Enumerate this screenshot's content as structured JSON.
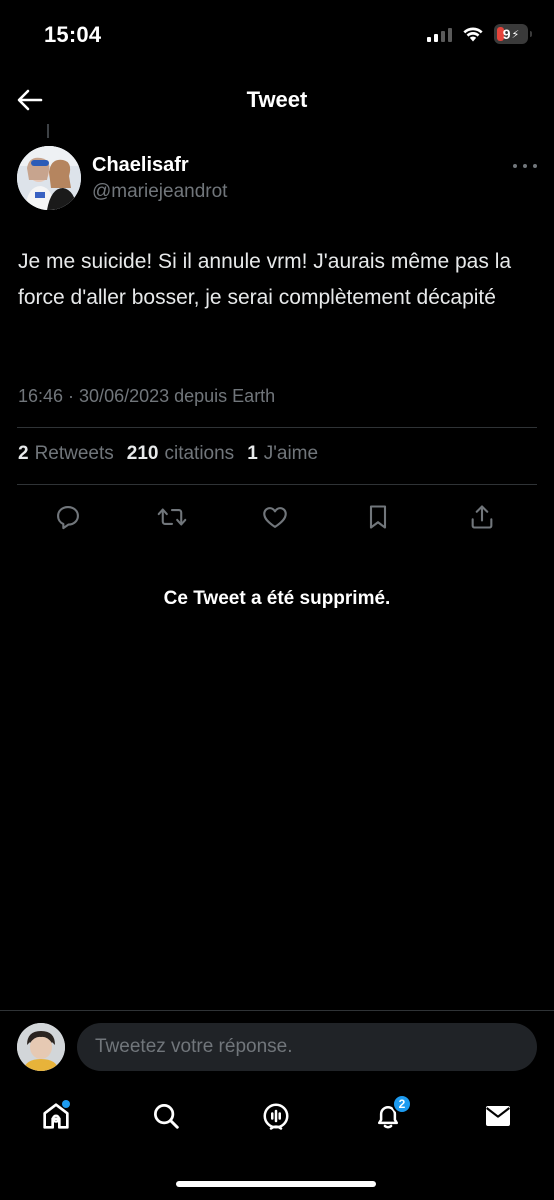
{
  "status_bar": {
    "time": "15:04",
    "battery_level": "9"
  },
  "header": {
    "title": "Tweet"
  },
  "tweet": {
    "author_name": "Chaelisafr",
    "author_handle": "@mariejeandrot",
    "text": "Je me suicide! Si il annule vrm! J'aurais même pas la force d'aller bosser, je serai complètement décapité",
    "meta": "16:46 · 30/06/2023 depuis Earth",
    "stats": {
      "retweets_count": "2",
      "retweets_label": "Retweets",
      "quotes_count": "210",
      "quotes_label": "citations",
      "likes_count": "1",
      "likes_label": "J'aime"
    }
  },
  "deleted_notice": "Ce Tweet a été supprimé.",
  "reply": {
    "placeholder": "Tweetez votre réponse."
  },
  "tab_bar": {
    "notifications_badge": "2"
  },
  "colors": {
    "background": "#000000",
    "text_primary": "#e7e9ea",
    "text_secondary": "#71767b",
    "accent": "#1d9bf0",
    "divider": "#2f3336"
  },
  "icons": {
    "header": [
      "back-arrow-icon"
    ],
    "tweet": [
      "more-options-icon"
    ],
    "actions": [
      "reply-icon",
      "retweet-icon",
      "like-icon",
      "bookmark-icon",
      "share-icon"
    ],
    "tab_bar": [
      "home-icon",
      "search-icon",
      "spaces-icon",
      "notifications-icon",
      "messages-icon"
    ]
  }
}
